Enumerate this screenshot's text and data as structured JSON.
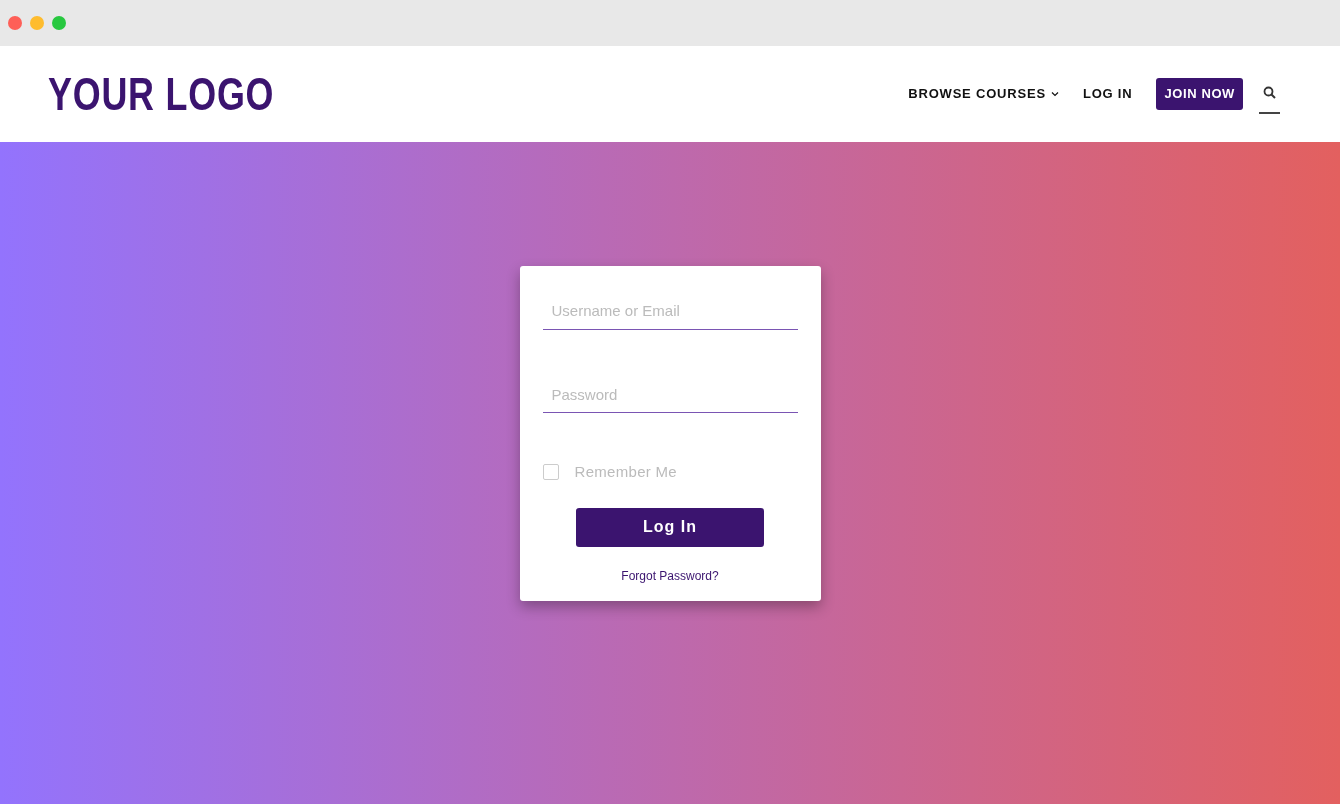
{
  "logo": "YOUR LOGO",
  "nav": [
    {
      "kind": "dropdown",
      "label": "BROWSE COURSES"
    },
    {
      "kind": "link",
      "label": "LOG IN"
    },
    {
      "kind": "button",
      "label": "JOIN NOW"
    },
    {
      "kind": "search"
    }
  ],
  "login_form": {
    "username": {
      "placeholder": "Username or Email"
    },
    "password": {
      "placeholder": "Password"
    },
    "remember": {
      "label": "Remember Me",
      "checked": false
    },
    "submit": "Log In",
    "forgot": "Forgot Password?"
  }
}
